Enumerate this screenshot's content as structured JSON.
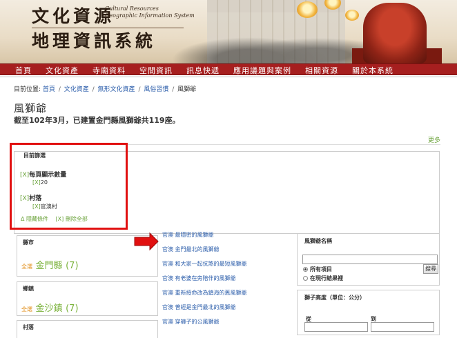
{
  "banner": {
    "title_line1": "文化資源",
    "title_line2": "地理資訊系統",
    "subtitle_line1": "Cultural Resources",
    "subtitle_line2": "Geographic Information System"
  },
  "nav": {
    "items": [
      "首頁",
      "文化資產",
      "寺廟資料",
      "空間資訊",
      "訊息快遞",
      "應用議題與案例",
      "相關資源",
      "關於本系統"
    ]
  },
  "breadcrumb": {
    "prefix": "目前位置:",
    "links": [
      "首頁",
      "文化資產",
      "無形文化資產",
      "風俗習慣"
    ],
    "current": "風獅爺",
    "separator": "/"
  },
  "page": {
    "title": "風獅爺",
    "subtitle": "截至102年3月，已建置金門縣風獅爺共119座。",
    "more_label": "更多"
  },
  "current_filters": {
    "title": "目前篩選",
    "x_mark": "[X]",
    "groups": [
      {
        "heading": "每頁顯示數量",
        "value": "20"
      },
      {
        "heading": "村落",
        "value": "官澳村"
      }
    ],
    "hide_label": "Δ 隱藏條件",
    "clear_label": "[X] 刪除全部"
  },
  "facets": {
    "county": {
      "title": "縣市",
      "all_label": "全選",
      "value": "金門縣",
      "count": "(7)"
    },
    "township": {
      "title": "鄉鎮",
      "all_label": "全選",
      "value": "金沙鎮",
      "count": "(7)"
    },
    "village": {
      "title": "村落"
    }
  },
  "results": [
    "官澳 最隱密的風獅爺",
    "官澳 金門最北的風獅爺",
    "官澳 和大家一起抗煞的最短風獅爺",
    "官澳 有老婆在旁陪伴的風獅爺",
    "官澳 重新授命改為鎮海的舊風獅爺",
    "官澳 曾經是金門最北的風獅爺",
    "官澳 穿褲子的公風獅爺"
  ],
  "search_panel": {
    "title": "風獅爺名稱",
    "button_label": "搜尋",
    "option_all": "所有項目",
    "option_current": "在現行結果裡"
  },
  "height_panel": {
    "title": "獅子高度（單位：公分）",
    "from_label": "從",
    "to_label": "到"
  },
  "colors": {
    "nav_bg": "#a61f1f",
    "link": "#2a5caa",
    "accent_green": "#6aa23a",
    "facet_orange": "#e08a10",
    "highlight_red": "#e11010"
  }
}
